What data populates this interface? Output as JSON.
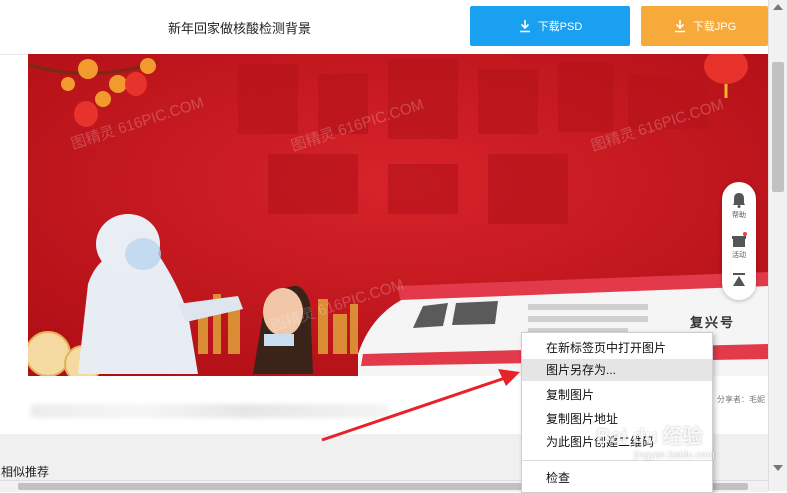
{
  "header": {
    "title": "新年回家做核酸检测背景",
    "download_psd_label": "下载PSD",
    "download_jpg_label": "下载JPG",
    "psd_color": "#1aa0f0",
    "jpg_color": "#f7a93a"
  },
  "banner": {
    "bg_color": "#c8161d",
    "watermark_text": "图精灵 616PIC.COM",
    "train_label": "复兴号"
  },
  "side_widget": {
    "items": [
      {
        "icon": "bell-icon",
        "label": "帮助"
      },
      {
        "icon": "gift-icon",
        "label": "活动"
      },
      {
        "icon": "back-to-top-icon",
        "label": ""
      }
    ]
  },
  "share": {
    "text": "分享者：毛妮"
  },
  "section": {
    "similar_title": "相似推荐"
  },
  "context_menu": {
    "items": [
      "在新标签页中打开图片",
      "图片另存为...",
      "复制图片",
      "复制图片地址",
      "为此图片创建二维码",
      "检查"
    ],
    "highlighted_index": 1
  },
  "overlay": {
    "arrow_color": "#e8222a",
    "watermark_brand": "Bai du 经验",
    "watermark_url": "jingyan.baidu.com"
  }
}
